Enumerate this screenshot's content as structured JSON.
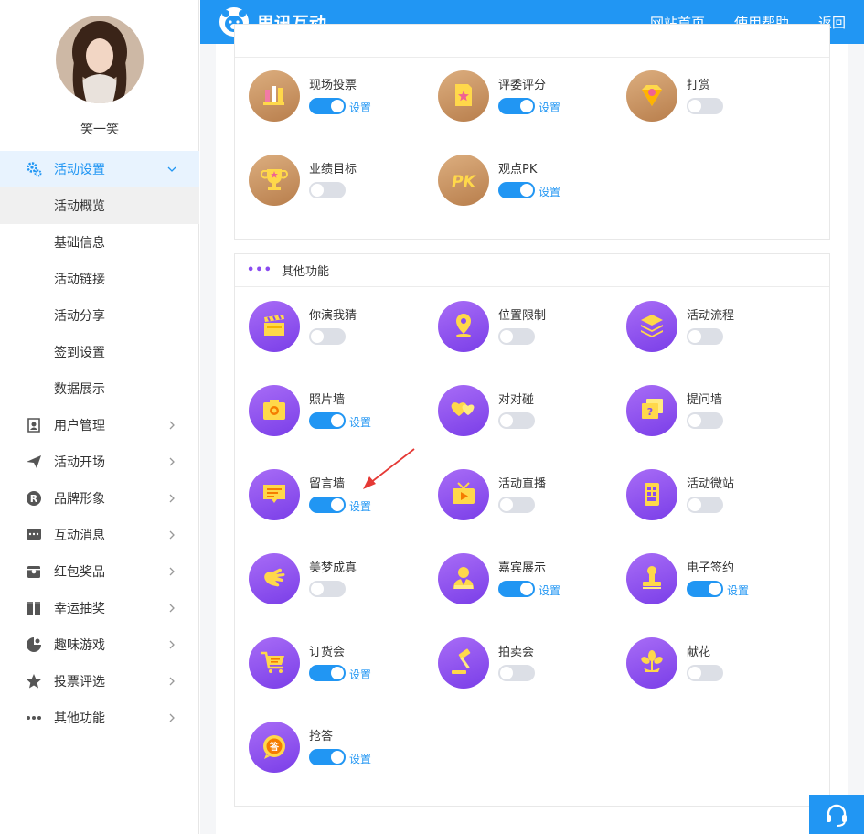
{
  "header": {
    "brand": "思讯互动",
    "nav": [
      "网站首页",
      "使用帮助",
      "返回"
    ]
  },
  "user": {
    "name": "笑一笑"
  },
  "sidebar": {
    "active": {
      "label": "活动设置",
      "icon": "gear-icon"
    },
    "sub_items": [
      "活动概览",
      "基础信息",
      "活动链接",
      "活动分享",
      "签到设置",
      "数据展示"
    ],
    "items": [
      {
        "label": "用户管理",
        "icon": "user-icon"
      },
      {
        "label": "活动开场",
        "icon": "paper-plane-icon"
      },
      {
        "label": "品牌形象",
        "icon": "registered-icon"
      },
      {
        "label": "互动消息",
        "icon": "chat-icon"
      },
      {
        "label": "红包奖品",
        "icon": "gift-box-icon"
      },
      {
        "label": "幸运抽奖",
        "icon": "lottery-icon"
      },
      {
        "label": "趣味游戏",
        "icon": "gamepad-icon"
      },
      {
        "label": "投票评选",
        "icon": "star-icon"
      },
      {
        "label": "其他功能",
        "icon": "more-icon"
      }
    ]
  },
  "voting_panel": {
    "features": [
      {
        "name": "现场投票",
        "on": true,
        "setting": "设置",
        "icon": "bar-chart-icon"
      },
      {
        "name": "评委评分",
        "on": true,
        "setting": "设置",
        "icon": "score-card-icon"
      },
      {
        "name": "打赏",
        "on": false,
        "setting": "",
        "icon": "diamond-icon"
      },
      {
        "name": "业绩目标",
        "on": false,
        "setting": "",
        "icon": "trophy-icon"
      },
      {
        "name": "观点PK",
        "on": true,
        "setting": "设置",
        "icon": "pk-icon",
        "icon_text": "PK"
      }
    ]
  },
  "other_panel": {
    "title": "其他功能",
    "features": [
      {
        "name": "你演我猜",
        "on": false,
        "setting": "",
        "icon": "clapperboard-icon"
      },
      {
        "name": "位置限制",
        "on": false,
        "setting": "",
        "icon": "location-pin-icon"
      },
      {
        "name": "活动流程",
        "on": false,
        "setting": "",
        "icon": "layers-icon"
      },
      {
        "name": "照片墙",
        "on": true,
        "setting": "设置",
        "icon": "camera-icon"
      },
      {
        "name": "对对碰",
        "on": false,
        "setting": "",
        "icon": "hearts-icon"
      },
      {
        "name": "提问墙",
        "on": false,
        "setting": "",
        "icon": "question-cards-icon"
      },
      {
        "name": "留言墙",
        "on": true,
        "setting": "设置",
        "icon": "message-board-icon"
      },
      {
        "name": "活动直播",
        "on": false,
        "setting": "",
        "icon": "live-video-icon"
      },
      {
        "name": "活动微站",
        "on": false,
        "setting": "",
        "icon": "micro-site-icon"
      },
      {
        "name": "美梦成真",
        "on": false,
        "setting": "",
        "icon": "hand-icon"
      },
      {
        "name": "嘉宾展示",
        "on": true,
        "setting": "设置",
        "icon": "guest-icon"
      },
      {
        "name": "电子签约",
        "on": true,
        "setting": "设置",
        "icon": "stamp-icon"
      },
      {
        "name": "订货会",
        "on": true,
        "setting": "设置",
        "icon": "cart-icon"
      },
      {
        "name": "拍卖会",
        "on": false,
        "setting": "",
        "icon": "gavel-icon"
      },
      {
        "name": "献花",
        "on": false,
        "setting": "",
        "icon": "flower-icon"
      },
      {
        "name": "抢答",
        "on": true,
        "setting": "设置",
        "icon": "quick-answer-icon",
        "icon_text": "答"
      }
    ]
  },
  "colors": {
    "primary": "#2196f3",
    "purple": "#8a4cf0",
    "gold": "#c8935f"
  }
}
